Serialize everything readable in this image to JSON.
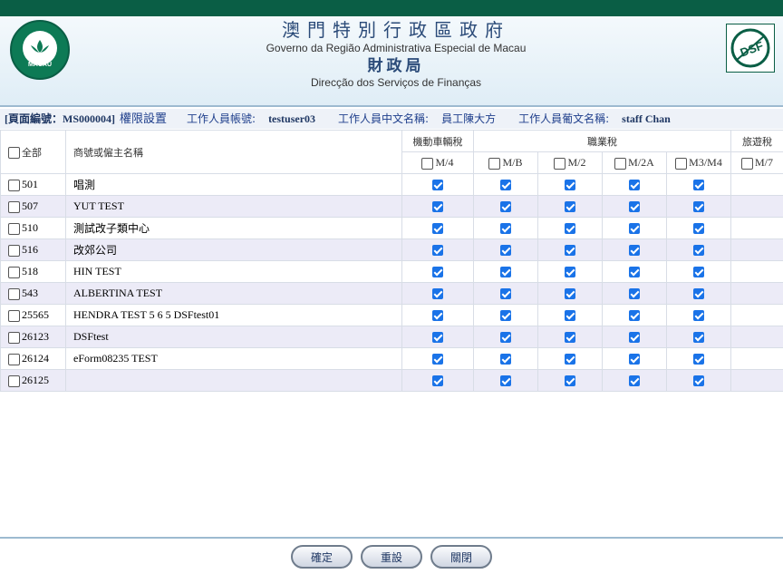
{
  "header": {
    "title_zh": "澳門特別行政區政府",
    "title_pt": "Governo da Região Administrativa Especial de Macau",
    "dept_zh": "財政局",
    "dept_pt": "Direcção dos Serviços de Finanças",
    "emblem_text": "MACAU",
    "dsf_logo": "DSF"
  },
  "info": {
    "page_code": "[頁面編號：MS000004]",
    "page_title": "權限設置",
    "account_label": "工作人員帳號:",
    "account_value": "testuser03",
    "cn_name_label": "工作人員中文名稱:",
    "cn_name_value": "員工陳大方",
    "pt_name_label": "工作人員葡文名稱:",
    "pt_name_value": "staff Chan"
  },
  "table": {
    "select_all": "全部",
    "name_header": "商號或僱主名稱",
    "group_vehicle": "機動車輛稅",
    "group_profession": "職業稅",
    "group_tourism": "旅遊稅",
    "columns": [
      "M/4",
      "M/B",
      "M/2",
      "M/2A",
      "M3/M4",
      "M/7"
    ],
    "rows": [
      {
        "id": "501",
        "name": "唱測"
      },
      {
        "id": "507",
        "name": "YUT TEST"
      },
      {
        "id": "510",
        "name": "測試改子類中心"
      },
      {
        "id": "516",
        "name": "改郊公司"
      },
      {
        "id": "518",
        "name": "HIN TEST"
      },
      {
        "id": "543",
        "name": "ALBERTINA TEST"
      },
      {
        "id": "25565",
        "name": "HENDRA TEST 5 6 5 DSFtest01"
      },
      {
        "id": "26123",
        "name": "DSFtest"
      },
      {
        "id": "26124",
        "name": "eForm08235 TEST"
      },
      {
        "id": "26125",
        "name": ""
      }
    ]
  },
  "buttons": {
    "confirm": "確定",
    "reset": "重設",
    "close": "關閉"
  },
  "colors": {
    "topbar": "#0a5e45",
    "row_alt": "#ecebf7",
    "checkbox_checked": "#1a73e8"
  }
}
